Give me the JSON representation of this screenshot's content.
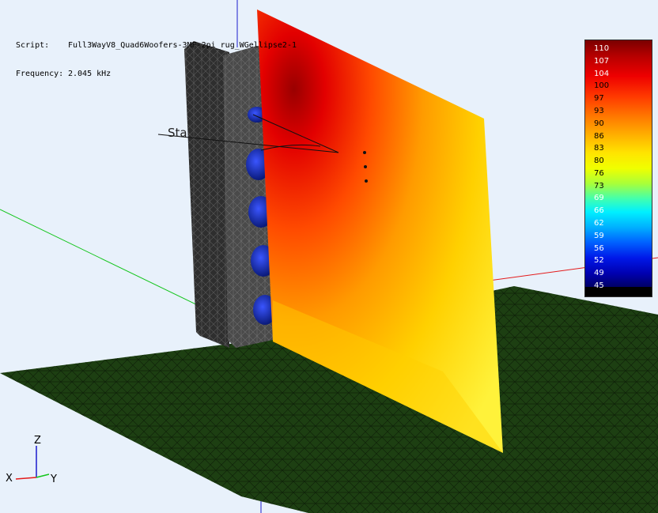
{
  "hud": {
    "script_label": "Script:",
    "script_value": "Full3WayV8_Quad6Woofers-3MF-2pi_rug_WGellipse2-1",
    "frequency_label": "Frequency:",
    "frequency_value": "2.045 kHz"
  },
  "scene": {
    "annotation_text": "Sta",
    "axis_labels": {
      "x": "X",
      "y": "Y",
      "z": "Z"
    }
  },
  "legend": {
    "values": [
      "110",
      "107",
      "104",
      "100",
      "97",
      "93",
      "90",
      "86",
      "83",
      "80",
      "76",
      "73",
      "69",
      "66",
      "62",
      "59",
      "56",
      "52",
      "49",
      "45"
    ]
  },
  "colors": {
    "floor": "#1d3f12",
    "cabinet": "#3a3a3a",
    "woofer": "#1a2fb0",
    "axis_x": "#e31a1a",
    "axis_y": "#12c51a",
    "axis_z": "#1a1acc"
  }
}
